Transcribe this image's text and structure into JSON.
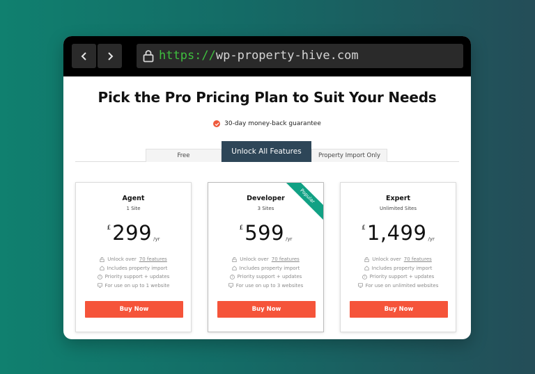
{
  "browser": {
    "url_scheme": "https://",
    "url_host": "wp-property-hive.com",
    "back_icon": "chevron-left-icon",
    "forward_icon": "chevron-right-icon",
    "lock_icon": "lock-icon"
  },
  "page": {
    "title": "Pick the Pro Pricing Plan to Suit Your Needs",
    "guarantee": "30-day money-back guarantee"
  },
  "tabs": [
    {
      "label": "Free",
      "active": false
    },
    {
      "label": "Unlock All Features",
      "active": true
    },
    {
      "label": "Property Import Only",
      "active": false
    }
  ],
  "plans": [
    {
      "name": "Agent",
      "sites": "1 Site",
      "currency": "£",
      "price": "299",
      "period": "/yr",
      "features": {
        "unlock_prefix": "Unlock over",
        "unlock_link": "70 features",
        "import": "Includes property import",
        "support": "Priority support + updates",
        "usage": "For use on up to 1 website"
      },
      "button": "Buy Now"
    },
    {
      "name": "Developer",
      "sites": "3 Sites",
      "currency": "£",
      "price": "599",
      "period": "/yr",
      "badge": "Popular",
      "features": {
        "unlock_prefix": "Unlock over",
        "unlock_link": "70 features",
        "import": "Includes property import",
        "support": "Priority support + updates",
        "usage": "For use on up to 3 websites"
      },
      "button": "Buy Now"
    },
    {
      "name": "Expert",
      "sites": "Unlimited Sites",
      "currency": "£",
      "price": "1,499",
      "period": "/yr",
      "features": {
        "unlock_prefix": "Unlock over",
        "unlock_link": "70 features",
        "import": "Includes property import",
        "support": "Priority support + updates",
        "usage": "For use on unlimited websites"
      },
      "button": "Buy Now"
    }
  ],
  "colors": {
    "accent": "#f5543a",
    "tab_active": "#2e4658",
    "ribbon": "#11a184"
  }
}
